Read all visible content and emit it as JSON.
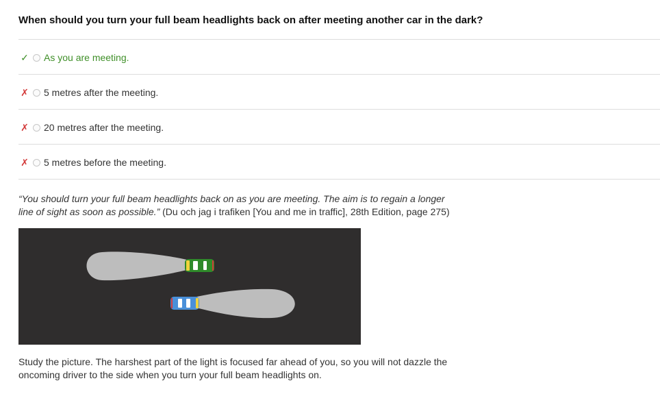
{
  "question": "When should you turn your full beam headlights back on after meeting another car in the dark?",
  "options": [
    {
      "mark": "✓",
      "status": "correct",
      "label": "As you are meeting."
    },
    {
      "mark": "✗",
      "status": "wrong",
      "label": "5 metres after the meeting."
    },
    {
      "mark": "✗",
      "status": "wrong",
      "label": "20 metres after the meeting."
    },
    {
      "mark": "✗",
      "status": "wrong",
      "label": "5 metres before the meeting."
    }
  ],
  "quote": {
    "italic": "“You should turn your full beam headlights back on as you are meeting. The aim is to regain a longer line of sight as soon as possible.”",
    "source": " (Du och jag i trafiken [You and me in traffic], 28th Edition, page 275)"
  },
  "explanation": "Study the picture. The harshest part of the light is focused far ahead of you, so you will not dazzle the oncoming driver to the side when you turn your full beam headlights on.",
  "colors": {
    "correct": "#3f8f28",
    "wrong": "#d33a3a",
    "road": "#2f2d2d",
    "beam": "#bdbdbd",
    "car_green": "#2f8a2a",
    "car_blue": "#4a90d9"
  }
}
